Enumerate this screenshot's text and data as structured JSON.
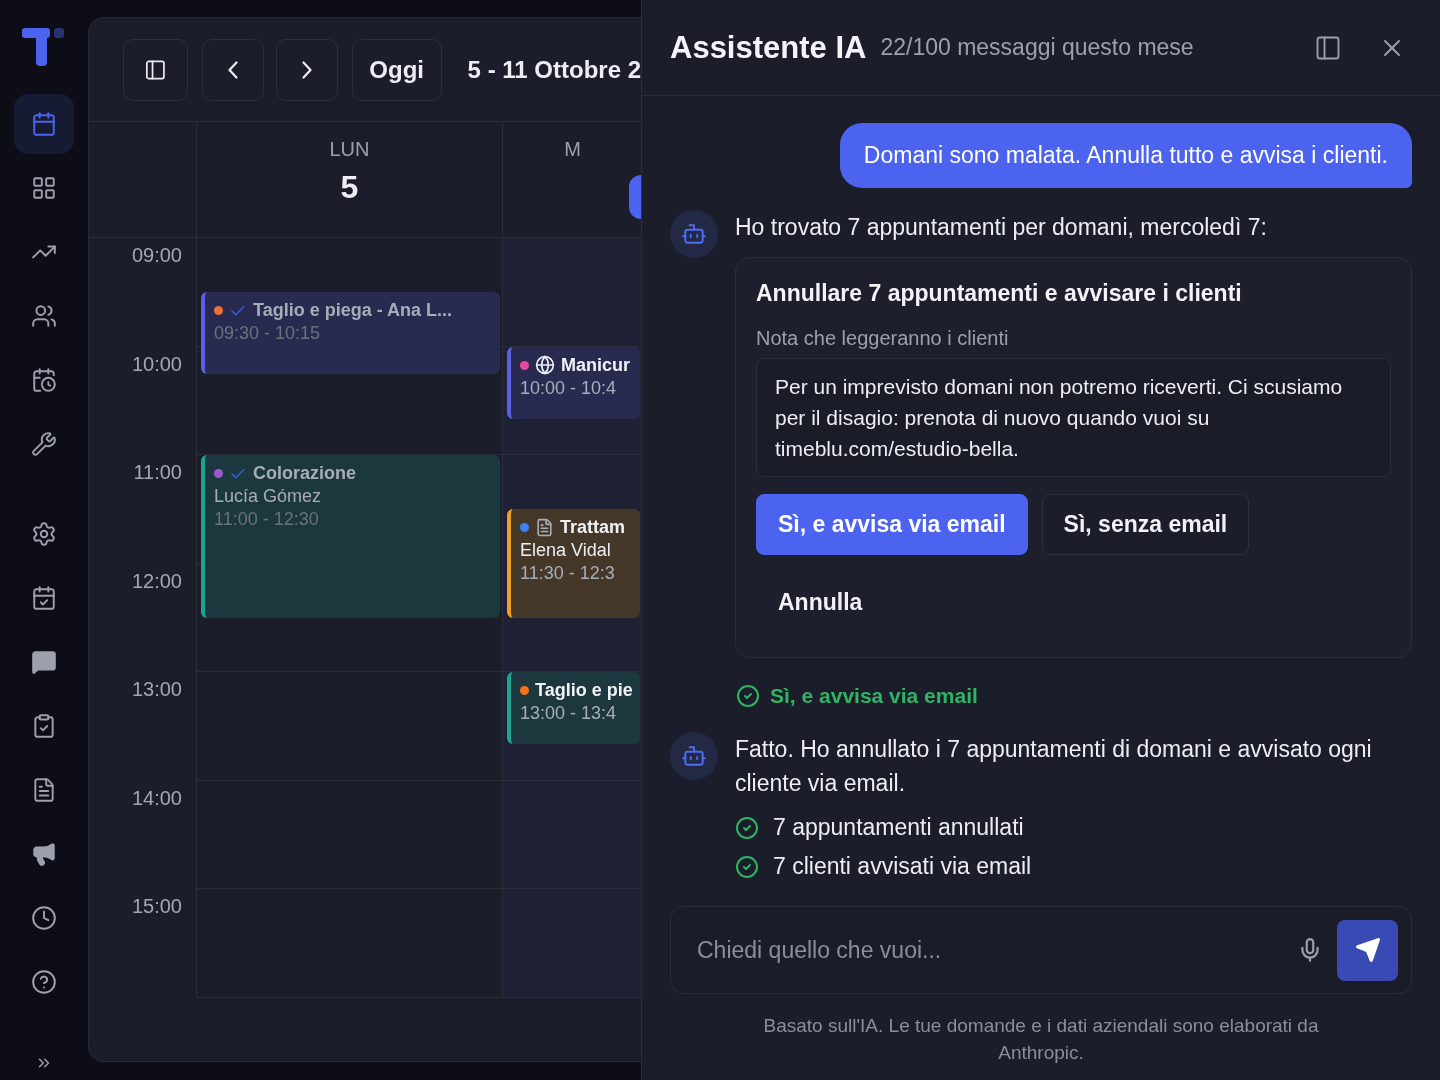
{
  "nav": {
    "items": [
      {
        "selected": true
      },
      {
        "selected": false
      },
      {
        "selected": false
      },
      {
        "selected": false
      },
      {
        "selected": false
      },
      {
        "selected": false
      },
      {
        "selected": false
      },
      {
        "selected": false
      },
      {
        "selected": false
      },
      {
        "selected": false
      },
      {
        "selected": false
      },
      {
        "selected": false
      },
      {
        "selected": false
      },
      {
        "selected": false
      }
    ]
  },
  "calendar": {
    "today_button": "Oggi",
    "range": "5 - 11 Ottobre 2",
    "hours": [
      "09:00",
      "10:00",
      "11:00",
      "12:00",
      "13:00",
      "14:00",
      "15:00"
    ],
    "days": [
      {
        "weekday": "LUN",
        "date": "5",
        "today": false,
        "events": [
          {
            "kind": "check",
            "color": "#5b5fe0",
            "status": {
              "color": "#e8733a"
            },
            "dimmed": true,
            "title": "Taglio e piega - Ana L...",
            "time": "09:30 - 10:15"
          },
          {
            "kind": "check",
            "color": "#1fa58f",
            "status": {
              "color": "#9b59d0"
            },
            "dimmed": true,
            "title": "Colorazione",
            "client": "Lucía Gómez",
            "time": "11:00 - 12:30"
          }
        ]
      },
      {
        "weekday": "M",
        "today": true,
        "events": [
          {
            "kind": "globe",
            "color": "#5b5fe0",
            "status": {
              "color": "#ec4899"
            },
            "dimmed": false,
            "title": "Manicur",
            "time": "10:00 - 10:4"
          },
          {
            "kind": "document",
            "color": "#f0a020",
            "status": {
              "color": "#3b82f6"
            },
            "dimmed": false,
            "title": "Trattam",
            "client": "Elena Vidal",
            "time": "11:30 - 12:3"
          },
          {
            "kind": "plain",
            "color": "#1fa58f",
            "status": {
              "color": "#f97316"
            },
            "dimmed": false,
            "title": "Taglio e pie",
            "time": "13:00 - 13:4"
          }
        ]
      }
    ]
  },
  "assistant": {
    "title": "Assistente IA",
    "usage": "22/100 messaggi questo mese",
    "messages": [
      {
        "kind": "user",
        "text": "Domani sono malata. Annulla tutto e avvisa i clienti."
      },
      {
        "kind": "bot",
        "text": "Ho trovato 7 appuntamenti per domani, mercoledì 7:",
        "card": {
          "title": "Annullare 7 appuntamenti e avvisare i clienti",
          "note_label": "Nota che leggeranno i clienti",
          "note": "Per un imprevisto domani non potremo riceverti. Ci scusiamo per il disagio: prenota di nuovo quando vuoi su timeblu.com/estudio-bella.",
          "buttons": [
            {
              "kind": "primary",
              "label": "Sì, e avvisa via email"
            },
            {
              "kind": "outline",
              "label": "Sì, senza email"
            },
            {
              "kind": "ghost",
              "label": "Annulla"
            }
          ]
        }
      },
      {
        "kind": "confirmation",
        "text": "Sì, e avvisa via email"
      },
      {
        "kind": "bot",
        "text": "Fatto. Ho annullato i 7 appuntamenti di domani e avvisato ogni cliente via email.",
        "results": [
          "7 appuntamenti annullati",
          "7 clienti avvisati via email"
        ]
      }
    ],
    "composer": {
      "placeholder": "Chiedi quello che vuoi..."
    },
    "footer": "Basato sull'IA. Le tue domande e i dati aziendali sono elaborati da Anthropic."
  }
}
